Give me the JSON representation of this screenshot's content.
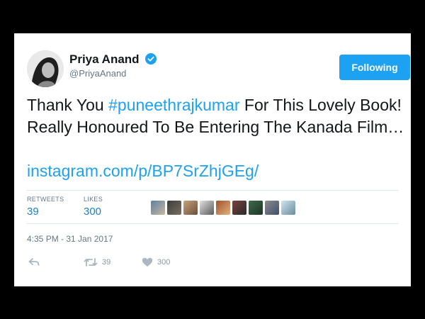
{
  "tweet": {
    "display_name": "Priya Anand",
    "handle": "@PriyaAnand",
    "follow_label": "Following",
    "text_before": "Thank You ",
    "hashtag": "#puneethrajkumar",
    "text_after": " For This Lovely Book! Really Honoured To Be Entering The Kanada Film…",
    "link": "instagram.com/p/BP7SrZhjGEg/",
    "retweets_label": "RETWEETS",
    "retweets_count": "39",
    "likes_label": "LIKES",
    "likes_count": "300",
    "timestamp": "4:35 PM - 31 Jan 2017",
    "reply_icon": "reply-icon",
    "retweet_action_count": "39",
    "like_action_count": "300"
  },
  "colors": {
    "accent": "#1da1f2",
    "count_blue": "#1d80c7",
    "muted": "#657786",
    "frame": "#000000"
  }
}
